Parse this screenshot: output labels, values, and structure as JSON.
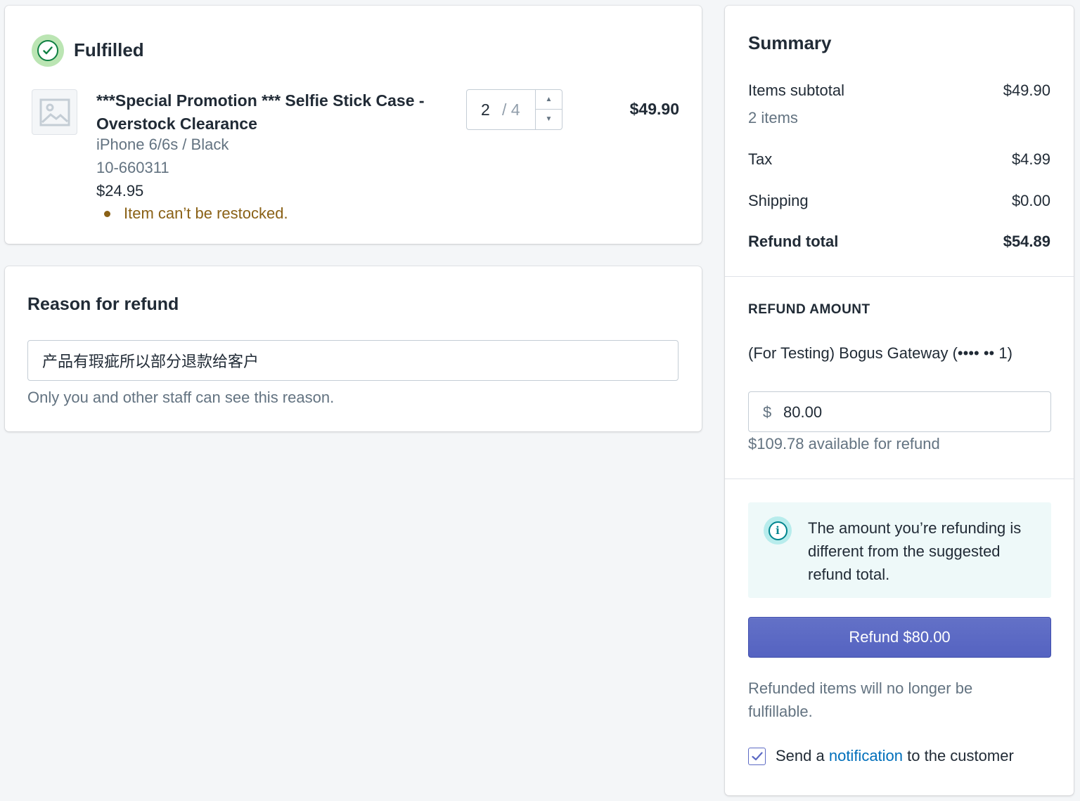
{
  "fulfilled": {
    "title": "Fulfilled",
    "item": {
      "title": "***Special Promotion *** Selfie Stick Case - Overstock Clearance",
      "variant": "iPhone 6/6s / Black",
      "sku": "10-660311",
      "unit_price": "$24.95",
      "restock_note": "Item can’t be restocked.",
      "quantity": "2",
      "quantity_max": "/ 4",
      "line_total": "$49.90"
    }
  },
  "reason": {
    "title": "Reason for refund",
    "value": "产品有瑕疵所以部分退款给客户",
    "help": "Only you and other staff can see this reason."
  },
  "summary": {
    "title": "Summary",
    "items_subtotal_label": "Items subtotal",
    "items_subtotal_value": "$49.90",
    "items_count": "2 items",
    "tax_label": "Tax",
    "tax_value": "$4.99",
    "shipping_label": "Shipping",
    "shipping_value": "$0.00",
    "refund_total_label": "Refund total",
    "refund_total_value": "$54.89"
  },
  "refund_amount": {
    "title": "REFUND AMOUNT",
    "gateway": "(For Testing) Bogus Gateway (•••• •• 1)",
    "currency": "$",
    "amount": "80.00",
    "available": "$109.78 available for refund",
    "banner_text": "The amount you’re refunding is different from the suggested refund total.",
    "button_label": "Refund $80.00",
    "fulfill_note": "Refunded items will no longer be fulfillable.",
    "notify_prefix": "Send a ",
    "notify_link": "notification",
    "notify_suffix": " to the customer"
  },
  "colors": {
    "primary": "#5c6ac4",
    "success": "#108043",
    "warning_text": "#8a6116",
    "info": "#00848e",
    "link": "#006fbb"
  }
}
